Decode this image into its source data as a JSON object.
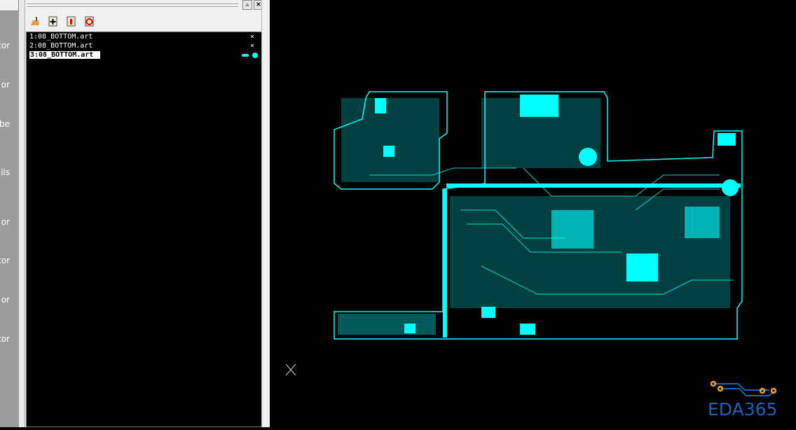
{
  "left_sidebar": {
    "items": [
      "tor",
      "or",
      "be",
      "ails",
      "or",
      "tor",
      "or",
      "itor"
    ]
  },
  "panel": {
    "toolbar": [
      "clear-icon",
      "add-layer-icon",
      "remove-layer-icon",
      "delete-all-icon"
    ],
    "layers": [
      {
        "label": "1:08_BOTTOM.art",
        "state": "×"
      },
      {
        "label": "2:08_BOTTOM.art",
        "state": "×"
      },
      {
        "label": "3:08_BOTTOM.art",
        "selected": true,
        "color": "#00ffff"
      }
    ],
    "close": "×"
  },
  "canvas": {
    "trace_color": "#00ffff",
    "origin_marker": "✕"
  },
  "watermark": {
    "text": "EDA365"
  }
}
